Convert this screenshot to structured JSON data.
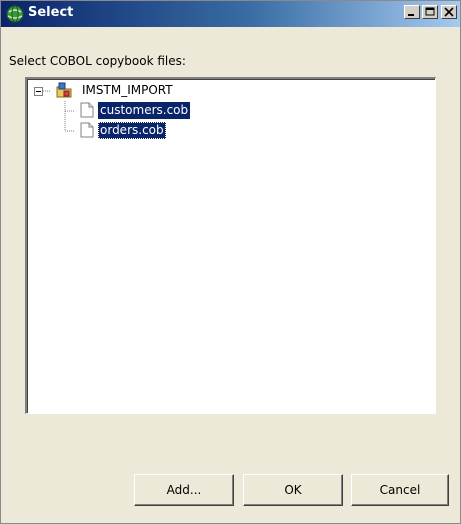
{
  "window": {
    "title": "Select",
    "title_icon": "globe-icon",
    "controls": {
      "minimize": "minimize-icon",
      "maximize": "maximize-icon",
      "close": "close-icon"
    }
  },
  "prompt": "Select COBOL copybook files:",
  "tree": {
    "root": {
      "label": "IMSTM_IMPORT",
      "icon": "project-folder-icon",
      "expanded": true
    },
    "children": [
      {
        "label": "customers.cob",
        "icon": "file-icon",
        "selected": true
      },
      {
        "label": "orders.cob",
        "icon": "file-icon",
        "selected": true,
        "focused": true
      }
    ]
  },
  "buttons": {
    "add": "Add...",
    "ok": "OK",
    "cancel": "Cancel"
  },
  "colors": {
    "selection": "#0a246a",
    "title_gradient_start": "#0a246a",
    "title_gradient_end": "#a6caf0"
  }
}
